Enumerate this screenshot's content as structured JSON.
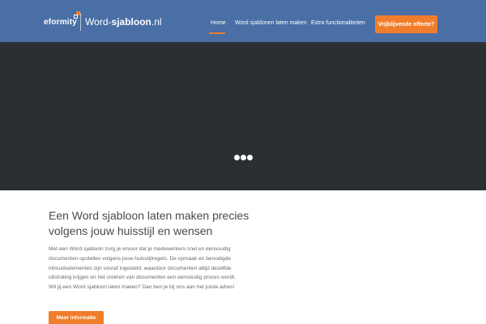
{
  "header": {
    "logo_brand": "eformity",
    "logo_site_prefix": "Word-",
    "logo_site_bold": "sjabloon",
    "logo_site_suffix": ".nl",
    "nav": [
      {
        "label": "Home",
        "active": true
      },
      {
        "label": "Word sjablonen laten maken",
        "active": false
      },
      {
        "label": "Extra functionaliteiten",
        "active": false
      }
    ],
    "cta_label": "Vrijblijvende offerte?"
  },
  "hero": {
    "loader_icon": "loading-dots-icon"
  },
  "content": {
    "headline": "Een Word sjabloon laten maken precies volgens jouw huisstijl en wensen",
    "body": "Met een Word sjabloon zorg je ervoor dat je medewerkers snel en eenvoudig documenten opstellen volgens jouw huisstijlregels. De opmaak en benodigde inhoudselementen zijn vooraf ingesteld, waardoor documenten altijd dezelfde uitstraling krijgen en het creëren van documenten een eenvoudig proces wordt. Wil jij een Word sjabloon laten maken? Dan ben je bij ons aan het juiste adres!",
    "more_label": "Meer informatie"
  },
  "colors": {
    "header_bg": "#4a6fa5",
    "accent": "#f07d2b",
    "hero_bg": "#2b2f33"
  }
}
